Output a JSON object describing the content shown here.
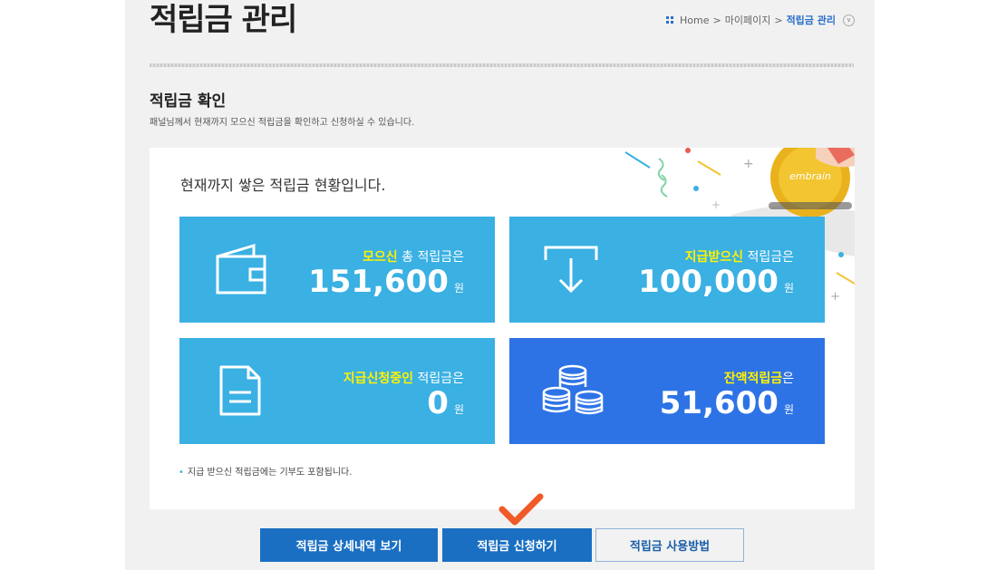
{
  "header": {
    "title": "적립금 관리",
    "breadcrumb": [
      "Home",
      "마이페이지",
      "적립금 관리"
    ],
    "separator": ">"
  },
  "section": {
    "title": "적립금 확인",
    "description": "패널님께서 현재까지 모으신 적립금을 확인하고 신청하실 수 있습니다."
  },
  "panel": {
    "heading": "현재까지 쌓은 적립금 현황입니다.",
    "coin_text": "embrain",
    "note": "지급 받으신 적립금에는 기부도 포함됩니다."
  },
  "cards": [
    {
      "highlight": "모으신",
      "label_rest": " 총 적립금은",
      "amount": "151,600",
      "unit": "원",
      "icon": "wallet-icon"
    },
    {
      "highlight": "지급받으신",
      "label_rest": " 적립금은",
      "amount": "100,000",
      "unit": "원",
      "icon": "download-icon"
    },
    {
      "highlight": "지급신청중인",
      "label_rest": " 적립금은",
      "amount": "0",
      "unit": "원",
      "icon": "document-icon"
    },
    {
      "highlight": "잔액적립금",
      "label_rest": "은",
      "amount": "51,600",
      "unit": "원",
      "icon": "coins-icon"
    }
  ],
  "buttons": {
    "details": "적립금 상세내역 보기",
    "apply": "적립금 신청하기",
    "howto": "적립금 사용방법"
  },
  "colors": {
    "card_blue": "#3ab0e3",
    "card_dark_blue": "#2d73e6",
    "highlight": "#fff200",
    "button_blue": "#1a6fc2",
    "check": "#f05a28"
  }
}
